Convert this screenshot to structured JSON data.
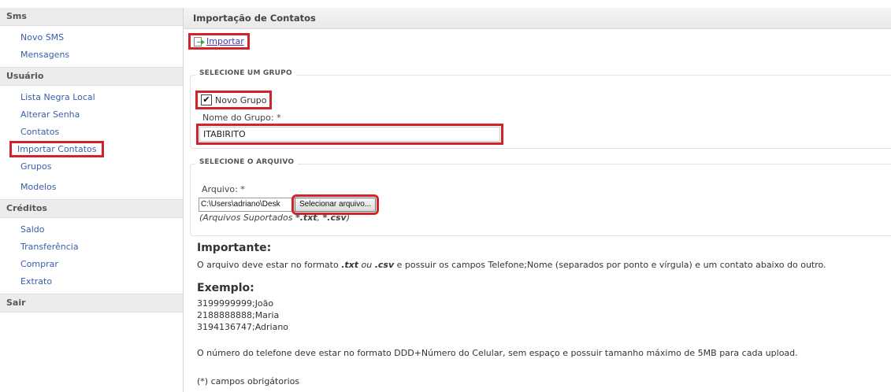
{
  "sidebar": {
    "sections": [
      {
        "title": "Sms",
        "items": [
          "Novo SMS",
          "Mensagens"
        ]
      },
      {
        "title": "Usuário",
        "items": [
          "Lista Negra Local",
          "Alterar Senha",
          "Contatos",
          "Importar Contatos",
          "Grupos",
          "Modelos"
        ]
      },
      {
        "title": "Créditos",
        "items": [
          "Saldo",
          "Transferência",
          "Comprar",
          "Extrato"
        ]
      },
      {
        "title": "Sair",
        "items": []
      }
    ]
  },
  "main": {
    "title": "Importação de Contatos",
    "import_link": "Importar",
    "group_section": {
      "legend": "SELECIONE UM GRUPO",
      "new_group_checkbox_label": "Novo Grupo",
      "new_group_checked": true,
      "group_name_label": "Nome do Grupo: *",
      "group_name_value": "ITABIRITO"
    },
    "file_section": {
      "legend": "SELECIONE O ARQUIVO",
      "file_label": "Arquivo: *",
      "file_path": "C:\\Users\\adriano\\Desk",
      "select_button": "Selecionar arquivo...",
      "supported_prefix": "(Arquivos Suportados ",
      "supported_ext1": "*.txt",
      "supported_sep": ", ",
      "supported_ext2": "*.csv",
      "supported_suffix": ")"
    },
    "important": {
      "heading": "Importante:",
      "text_prefix": "O arquivo deve estar no formato ",
      "fmt_txt": ".txt",
      "ou": " ou ",
      "fmt_csv": ".csv",
      "text_suffix": " e possuir os campos Telefone;Nome (separados por ponto e vírgula) e um contato abaixo do outro."
    },
    "example": {
      "heading": "Exemplo:",
      "lines": [
        "3199999999;João",
        "2188888888;Maria",
        "3194136747;Adriano"
      ]
    },
    "phone_note": "O número do telefone deve estar no formato DDD+Número do Celular, sem espaço e possuir tamanho máximo de 5MB para cada upload.",
    "required_note": "(*) campos obrigátorios"
  },
  "colors": {
    "highlight": "#d2232a",
    "link": "#3a5db0"
  }
}
